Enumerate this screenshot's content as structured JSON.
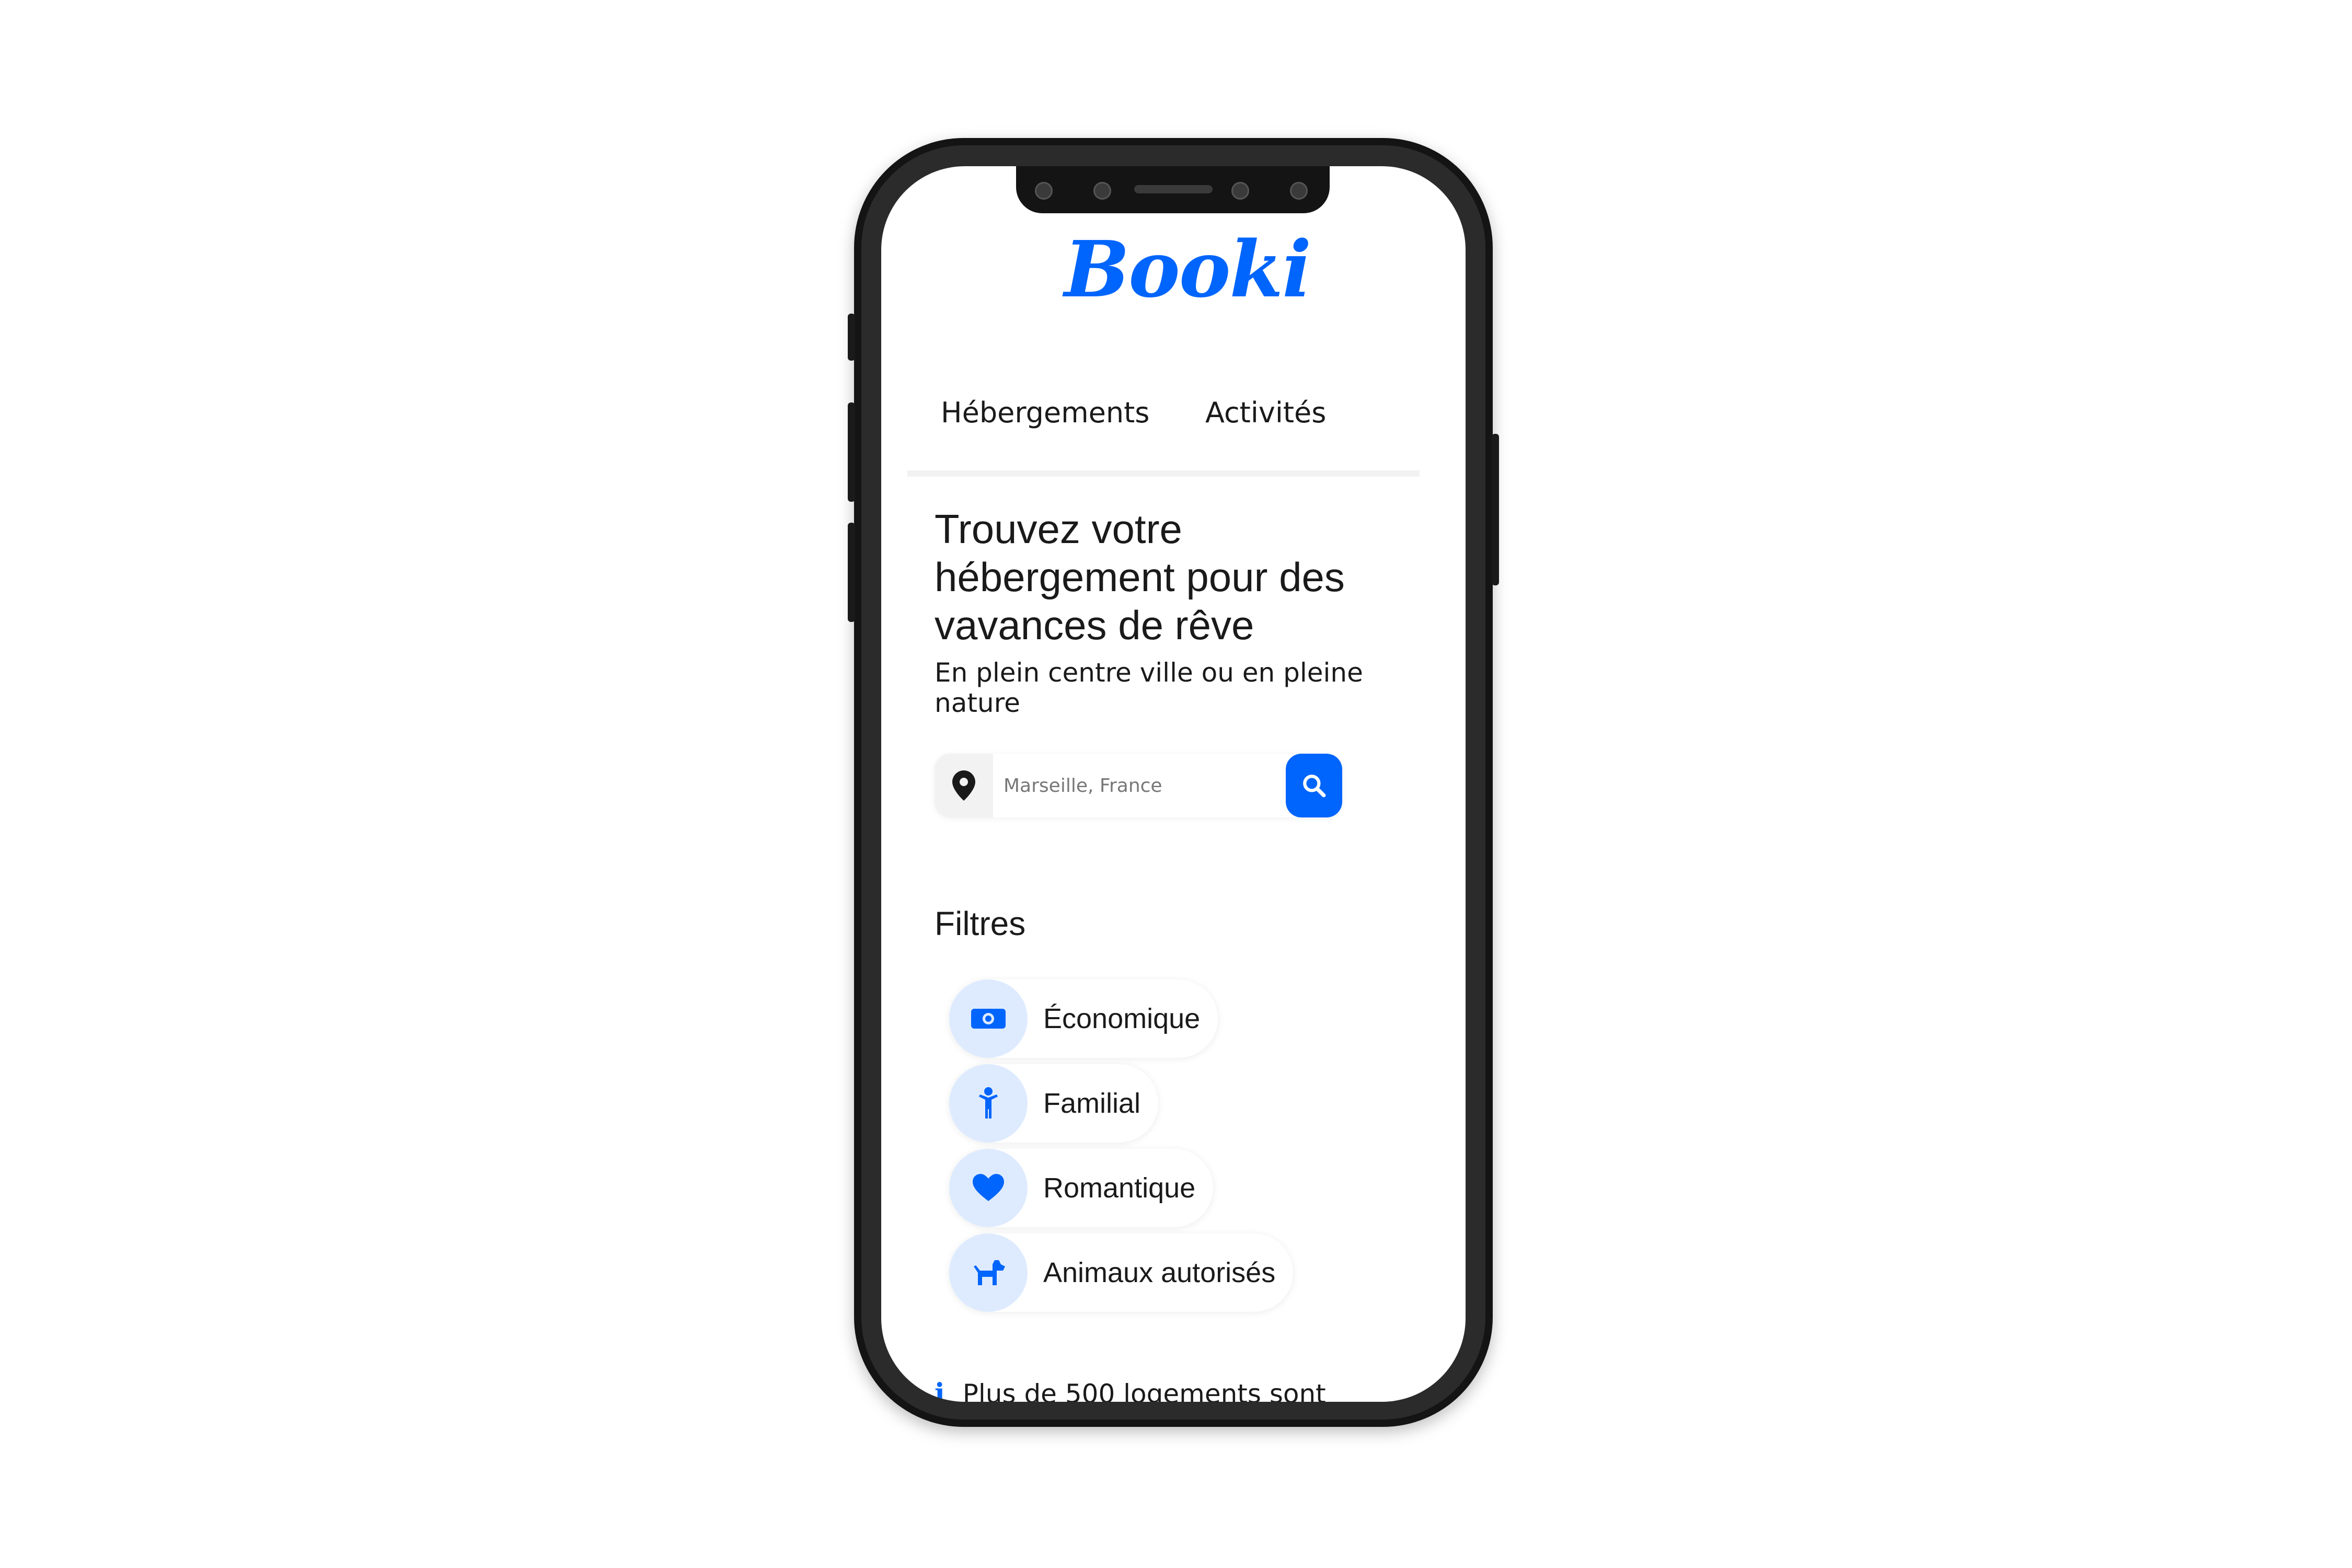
{
  "brand": {
    "logo_text": "Booki",
    "accent_color": "#0065fc",
    "accent_light": "#deebff"
  },
  "nav": {
    "items": [
      {
        "label": "Hébergements"
      },
      {
        "label": "Activités"
      }
    ]
  },
  "hero": {
    "title": "Trouvez votre hébergement pour des vavances de rêve",
    "subtitle": "En plein centre ville ou en pleine nature"
  },
  "search": {
    "placeholder": "Marseille, France",
    "location_icon": "map-pin-icon",
    "submit_icon": "search-icon"
  },
  "filters": {
    "title": "Filtres",
    "items": [
      {
        "label": "Économique",
        "icon": "money-icon"
      },
      {
        "label": "Familial",
        "icon": "child-icon"
      },
      {
        "label": "Romantique",
        "icon": "heart-icon"
      },
      {
        "label": "Animaux autorisés",
        "icon": "dog-icon"
      }
    ]
  },
  "info": {
    "text": "Plus de 500 logements sont",
    "icon": "info-icon"
  }
}
